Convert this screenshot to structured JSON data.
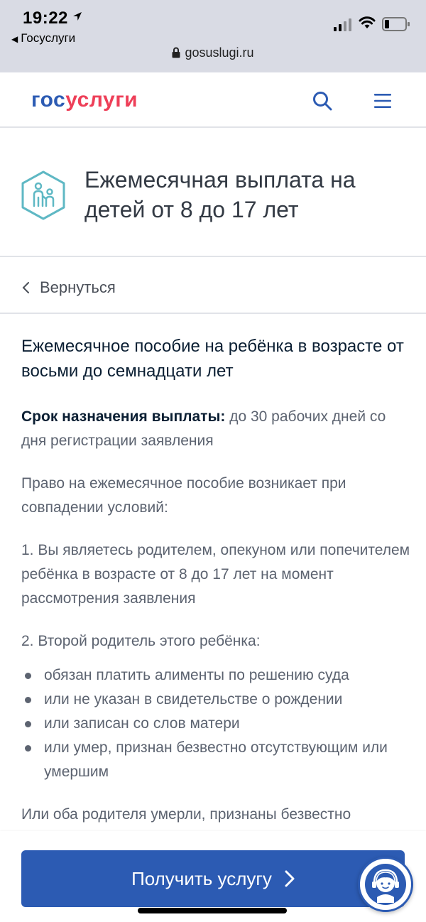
{
  "status_bar": {
    "time": "19:22",
    "back_app": "Госуслуги",
    "url": "gosuslugi.ru"
  },
  "header": {
    "logo_part1": "гос",
    "logo_part2": "услуги",
    "search_icon": "search-icon",
    "menu_icon": "hamburger-menu-icon"
  },
  "service": {
    "icon": "family-children-icon",
    "title": "Ежемесячная выплата на детей от 8 до 17 лет"
  },
  "back": {
    "label": "Вернуться"
  },
  "content": {
    "heading": "Ежемесячное пособие на ребёнка в возрасте от восьми до семнадцати лет",
    "term_label": "Срок назначения выплаты:",
    "term_text": " до 30 рабочих дней со дня регистрации заявления",
    "intro": "Право на ежемесячное пособие возникает при совпадении условий:",
    "condition1": "1. Вы являетесь родителем, опекуном или попечителем ребёнка в возрасте от 8 до 17 лет на момент рассмотрения заявления",
    "condition2": "2. Второй родитель этого ребёнка:",
    "bullets": [
      "обязан платить алименты по решению суда",
      "или не указан в свидетельстве о рождении",
      "или записан со слов матери",
      "или умер, признан безвестно отсутствующим или умершим"
    ],
    "tail": "Или оба родителя умерли, признаны безвестно"
  },
  "cta": {
    "label": "Получить услугу"
  },
  "support": {
    "icon": "support-operator-icon"
  },
  "colors": {
    "brand_blue": "#2c5bb3",
    "brand_red": "#ee3f58",
    "icon_teal": "#5fb8c4"
  }
}
